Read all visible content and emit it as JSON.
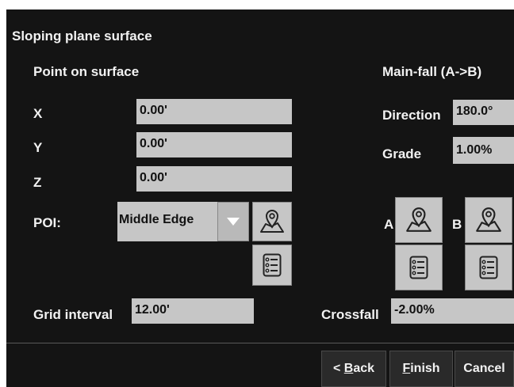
{
  "dialog": {
    "title": "Sloping plane surface",
    "point_section_label": "Point on surface",
    "mainfall_section_label": "Main-fall (A->B)"
  },
  "point": {
    "x_label": "X",
    "x_value": "0.00'",
    "y_label": "Y",
    "y_value": "0.00'",
    "z_label": "Z",
    "z_value": "0.00'",
    "poi_label": "POI:",
    "poi_value": "Middle Edge"
  },
  "mainfall": {
    "direction_label": "Direction",
    "direction_value": "180.0°",
    "grade_label": "Grade",
    "grade_value": "1.00%",
    "a_label": "A",
    "b_label": "B"
  },
  "grid": {
    "label": "Grid interval",
    "value": "12.00'"
  },
  "crossfall": {
    "label": "Crossfall",
    "value": "-2.00%"
  },
  "buttons": {
    "back_prefix": "< ",
    "back_mnemonic": "B",
    "back_rest": "ack",
    "finish_mnemonic": "F",
    "finish_rest": "inish",
    "cancel_label": "Cancel"
  },
  "icons": {
    "map_pick": "map-pin-icon",
    "list": "list-icon",
    "dropdown": "triangle-down-icon"
  }
}
